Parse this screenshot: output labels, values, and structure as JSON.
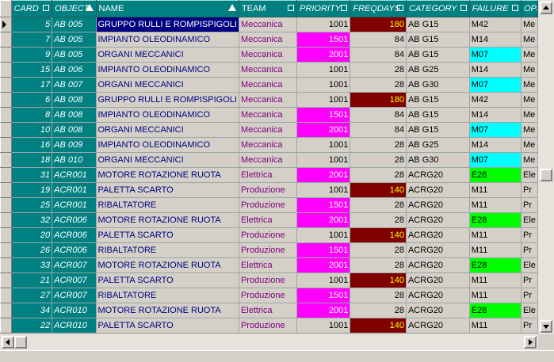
{
  "columns": [
    "CARD",
    "OBJECT",
    "NAME",
    "TEAM",
    "PRIORITY",
    "FREQDAYS",
    "CATEGORY",
    "FAILURE",
    "OPER"
  ],
  "colors": {
    "header": "#008080",
    "magenta": "#ff00ff",
    "darkred": "#800000",
    "cyan": "#00ffff",
    "green": "#00ff00",
    "name_text": "#000080",
    "team_text": "#800080"
  },
  "rows": [
    {
      "card": "5",
      "object": "AB 005",
      "name": "GRUPPO RULLI E ROMPISPIGOLI",
      "team": "Meccanica",
      "priority": "1001",
      "freq": "180",
      "category": "AB G15",
      "failure": "M42",
      "next": "Me"
    },
    {
      "card": "7",
      "object": "AB 005",
      "name": "IMPIANTO OLEODINAMICO",
      "team": "Meccanica",
      "priority": "1501",
      "freq": "84",
      "category": "AB G15",
      "failure": "M14",
      "next": "Me"
    },
    {
      "card": "9",
      "object": "AB 005",
      "name": "ORGANI MECCANICI",
      "team": "Meccanica",
      "priority": "2001",
      "freq": "84",
      "category": "AB G15",
      "failure": "M07",
      "next": "Me"
    },
    {
      "card": "15",
      "object": "AB 006",
      "name": "IMPIANTO OLEODINAMICO",
      "team": "Meccanica",
      "priority": "1001",
      "freq": "28",
      "category": "AB G25",
      "failure": "M14",
      "next": "Me"
    },
    {
      "card": "17",
      "object": "AB 007",
      "name": "ORGANI MECCANICI",
      "team": "Meccanica",
      "priority": "1001",
      "freq": "28",
      "category": "AB G30",
      "failure": "M07",
      "next": "Me"
    },
    {
      "card": "6",
      "object": "AB 008",
      "name": "GRUPPO RULLI E ROMPISPIGOLI",
      "team": "Meccanica",
      "priority": "1001",
      "freq": "180",
      "category": "AB G15",
      "failure": "M42",
      "next": "Me"
    },
    {
      "card": "8",
      "object": "AB 008",
      "name": "IMPIANTO OLEODINAMICO",
      "team": "Meccanica",
      "priority": "1501",
      "freq": "84",
      "category": "AB G15",
      "failure": "M14",
      "next": "Me"
    },
    {
      "card": "10",
      "object": "AB 008",
      "name": "ORGANI MECCANICI",
      "team": "Meccanica",
      "priority": "2001",
      "freq": "84",
      "category": "AB G15",
      "failure": "M07",
      "next": "Me"
    },
    {
      "card": "16",
      "object": "AB 009",
      "name": "IMPIANTO OLEODINAMICO",
      "team": "Meccanica",
      "priority": "1001",
      "freq": "28",
      "category": "AB G25",
      "failure": "M14",
      "next": "Me"
    },
    {
      "card": "18",
      "object": "AB 010",
      "name": "ORGANI MECCANICI",
      "team": "Meccanica",
      "priority": "1001",
      "freq": "28",
      "category": "AB G30",
      "failure": "M07",
      "next": "Me"
    },
    {
      "card": "31",
      "object": "ACR001",
      "name": "MOTORE ROTAZIONE RUOTA",
      "team": "Elettrica",
      "priority": "2001",
      "freq": "28",
      "category": "ACRG20",
      "failure": "E28",
      "next": "Ele"
    },
    {
      "card": "19",
      "object": "ACR001",
      "name": "PALETTA SCARTO",
      "team": "Produzione",
      "priority": "1001",
      "freq": "140",
      "category": "ACRG20",
      "failure": "M11",
      "next": "Pr"
    },
    {
      "card": "25",
      "object": "ACR001",
      "name": "RIBALTATORE",
      "team": "Produzione",
      "priority": "1501",
      "freq": "28",
      "category": "ACRG20",
      "failure": "M11",
      "next": "Pr"
    },
    {
      "card": "32",
      "object": "ACR006",
      "name": "MOTORE ROTAZIONE RUOTA",
      "team": "Elettrica",
      "priority": "2001",
      "freq": "28",
      "category": "ACRG20",
      "failure": "E28",
      "next": "Ele"
    },
    {
      "card": "20",
      "object": "ACR006",
      "name": "PALETTA SCARTO",
      "team": "Produzione",
      "priority": "1001",
      "freq": "140",
      "category": "ACRG20",
      "failure": "M11",
      "next": "Pr"
    },
    {
      "card": "26",
      "object": "ACR006",
      "name": "RIBALTATORE",
      "team": "Produzione",
      "priority": "1501",
      "freq": "28",
      "category": "ACRG20",
      "failure": "M11",
      "next": "Pr"
    },
    {
      "card": "33",
      "object": "ACR007",
      "name": "MOTORE ROTAZIONE RUOTA",
      "team": "Elettrica",
      "priority": "2001",
      "freq": "28",
      "category": "ACRG20",
      "failure": "E28",
      "next": "Ele"
    },
    {
      "card": "21",
      "object": "ACR007",
      "name": "PALETTA SCARTO",
      "team": "Produzione",
      "priority": "1001",
      "freq": "140",
      "category": "ACRG20",
      "failure": "M11",
      "next": "Pr"
    },
    {
      "card": "27",
      "object": "ACR007",
      "name": "RIBALTATORE",
      "team": "Produzione",
      "priority": "1501",
      "freq": "28",
      "category": "ACRG20",
      "failure": "M11",
      "next": "Pr"
    },
    {
      "card": "34",
      "object": "ACR010",
      "name": "MOTORE ROTAZIONE RUOTA",
      "team": "Elettrica",
      "priority": "2001",
      "freq": "28",
      "category": "ACRG20",
      "failure": "E28",
      "next": "Ele"
    },
    {
      "card": "22",
      "object": "ACR010",
      "name": "PALETTA SCARTO",
      "team": "Produzione",
      "priority": "1001",
      "freq": "140",
      "category": "ACRG20",
      "failure": "M11",
      "next": "Pr"
    }
  ]
}
